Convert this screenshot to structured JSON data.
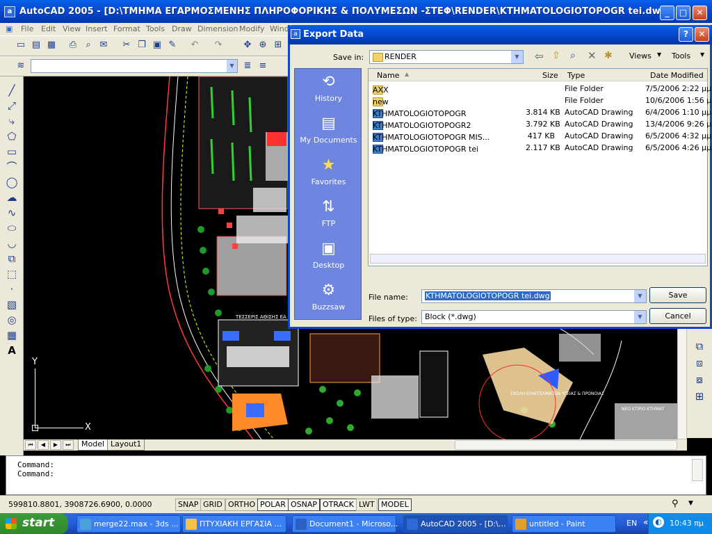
{
  "app": {
    "title": "AutoCAD 2005 - [D:\\ΤΜΗΜΑ ΕΓΑΡΜΟΣΜΕΝΗΣ ΠΛΗΡΟΦΟΡΙΚΗΣ & ΠΟΛΥΜΕΣΩΝ -ΣΤΕΦ\\RENDER\\KTHMATOLOGIOTOPOGR tei.dwg]",
    "icon_glyph": "a"
  },
  "menu": [
    "File",
    "Edit",
    "View",
    "Insert",
    "Format",
    "Tools",
    "Draw",
    "Dimension",
    "Modify",
    "Wind"
  ],
  "drawing": {
    "ucs_y": "Y",
    "ucs_x": "X",
    "annotation_1": "ΤΕΣΣΕΡΙΣ ΑΘΙΣΗΣ ΕΑ",
    "annotation_2": "ΣΧΟΛΗ ΕΠΑΓΓΕΛΜΑΤΩΝ ΥΓΕΙΑΣ & ΠΡΟΝΟΙΑΣ",
    "annotation_3": "ΝΕΟ ΚΤΙΡΙΟ ΚΤΗΜΑΤ"
  },
  "layout_tabs": [
    "Model",
    "Layout1"
  ],
  "command": {
    "line1": "Command:",
    "line2": "Command:"
  },
  "status": {
    "coords": "599810.8801, 3908726.6900, 0.0000",
    "buttons": [
      "SNAP",
      "GRID",
      "ORTHO",
      "POLAR",
      "OSNAP",
      "OTRACK",
      "LWT",
      "MODEL"
    ]
  },
  "dialog": {
    "title": "Export Data",
    "save_in_label": "Save in:",
    "save_in_value": "RENDER",
    "views_label": "Views",
    "tools_label": "Tools",
    "places": [
      "History",
      "My Documents",
      "Favorites",
      "FTP",
      "Desktop",
      "Buzzsaw"
    ],
    "columns": [
      "Name",
      "Size",
      "Type",
      "Date Modified"
    ],
    "files": [
      {
        "name": "AXX",
        "size": "",
        "type": "File Folder",
        "date": "7/5/2006 2:22 μμ",
        "kind": "folder"
      },
      {
        "name": "new",
        "size": "",
        "type": "File Folder",
        "date": "10/6/2006 1:56 μμ",
        "kind": "folder"
      },
      {
        "name": "KTHMATOLOGIOTOPOGR",
        "size": "3.814 KB",
        "type": "AutoCAD Drawing",
        "date": "6/4/2006 1:10 μμ",
        "kind": "dwg"
      },
      {
        "name": "KTHMATOLOGIOTOPOGR2",
        "size": "3.792 KB",
        "type": "AutoCAD Drawing",
        "date": "13/4/2006 9:26 μμ",
        "kind": "dwg"
      },
      {
        "name": "KTHMATOLOGIOTOPOGR MIS...",
        "size": "417 KB",
        "type": "AutoCAD Drawing",
        "date": "6/5/2006 4:32 μμ",
        "kind": "dwg"
      },
      {
        "name": "KTHMATOLOGIOTOPOGR tei",
        "size": "2.117 KB",
        "type": "AutoCAD Drawing",
        "date": "6/5/2006 4:26 μμ",
        "kind": "dwg"
      }
    ],
    "file_name_label": "File name:",
    "file_name_value": "KTHMATOLOGIOTOPOGR tei.dwg",
    "files_of_type_label": "Files of type:",
    "files_of_type_value": "Block (*.dwg)",
    "save_button": "Save",
    "cancel_button": "Cancel",
    "help_glyph": "?",
    "close_glyph": "✕"
  },
  "taskbar": {
    "start_label": "start",
    "tasks": [
      {
        "label": "merge22.max - 3ds ...",
        "active": false,
        "color": "#4aa0d8"
      },
      {
        "label": "ΠΤΥΧΙΑΚΗ ΕΡΓΑΣΙΑ ...",
        "active": false,
        "color": "#f3c24a"
      },
      {
        "label": "Document1 - Microso...",
        "active": false,
        "color": "#2b5fc0"
      },
      {
        "label": "AutoCAD 2005 - [D:\\...",
        "active": true,
        "color": "#2d6ad7"
      },
      {
        "label": "untitled - Paint",
        "active": false,
        "color": "#e0a030"
      }
    ],
    "lang": "EN",
    "time": "10:43 πμ"
  }
}
